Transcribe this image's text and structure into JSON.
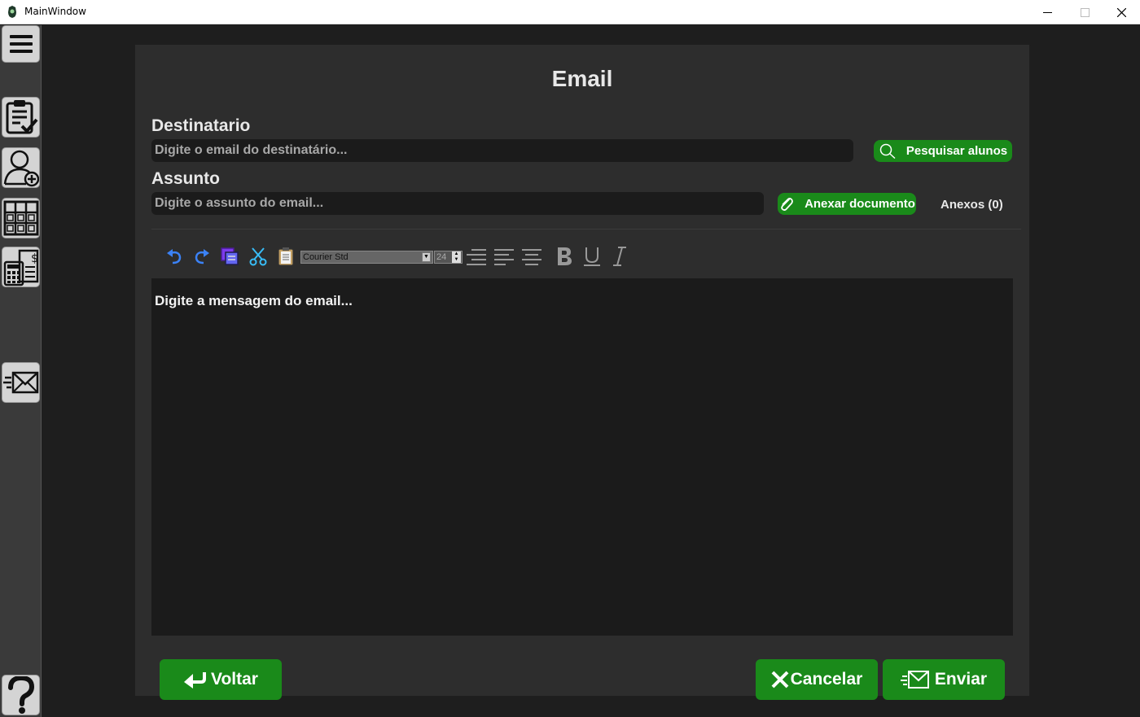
{
  "window": {
    "title": "MainWindow"
  },
  "sidebar": {
    "items": [
      {
        "name": "menu",
        "icon": "hamburger-menu-icon"
      },
      {
        "name": "tasks",
        "icon": "clipboard-check-icon"
      },
      {
        "name": "add-user",
        "icon": "add-user-icon"
      },
      {
        "name": "calendar",
        "icon": "calendar-grid-icon"
      },
      {
        "name": "finance",
        "icon": "calculator-money-icon"
      },
      {
        "name": "email",
        "icon": "send-email-icon"
      },
      {
        "name": "help",
        "icon": "help-icon"
      }
    ]
  },
  "email": {
    "title": "Email",
    "recipient_label": "Destinatario",
    "recipient_placeholder": "Digite o email do destinatário...",
    "search_students_label": "Pesquisar alunos",
    "subject_label": "Assunto",
    "subject_placeholder": "Digite o assunto do email...",
    "attach_label": "Anexar documento",
    "attachments_count": "Anexos (0)",
    "message_placeholder": "Digite a mensagem do email..."
  },
  "toolbar": {
    "font": "Courier Std",
    "font_size": "24",
    "icons": [
      "undo-icon",
      "redo-icon",
      "copy-icon",
      "cut-icon",
      "paste-icon",
      "align-right-icon",
      "align-left-icon",
      "align-center-icon",
      "bold-icon",
      "underline-icon",
      "italic-icon"
    ]
  },
  "footer": {
    "back_label": "Voltar",
    "cancel_label": "Cancelar",
    "send_label": "Enviar"
  },
  "colors": {
    "accent_green": "#1a8a1a",
    "panel": "#2d2d2d",
    "background": "#1e1e1e",
    "field": "#1b1b1b"
  }
}
